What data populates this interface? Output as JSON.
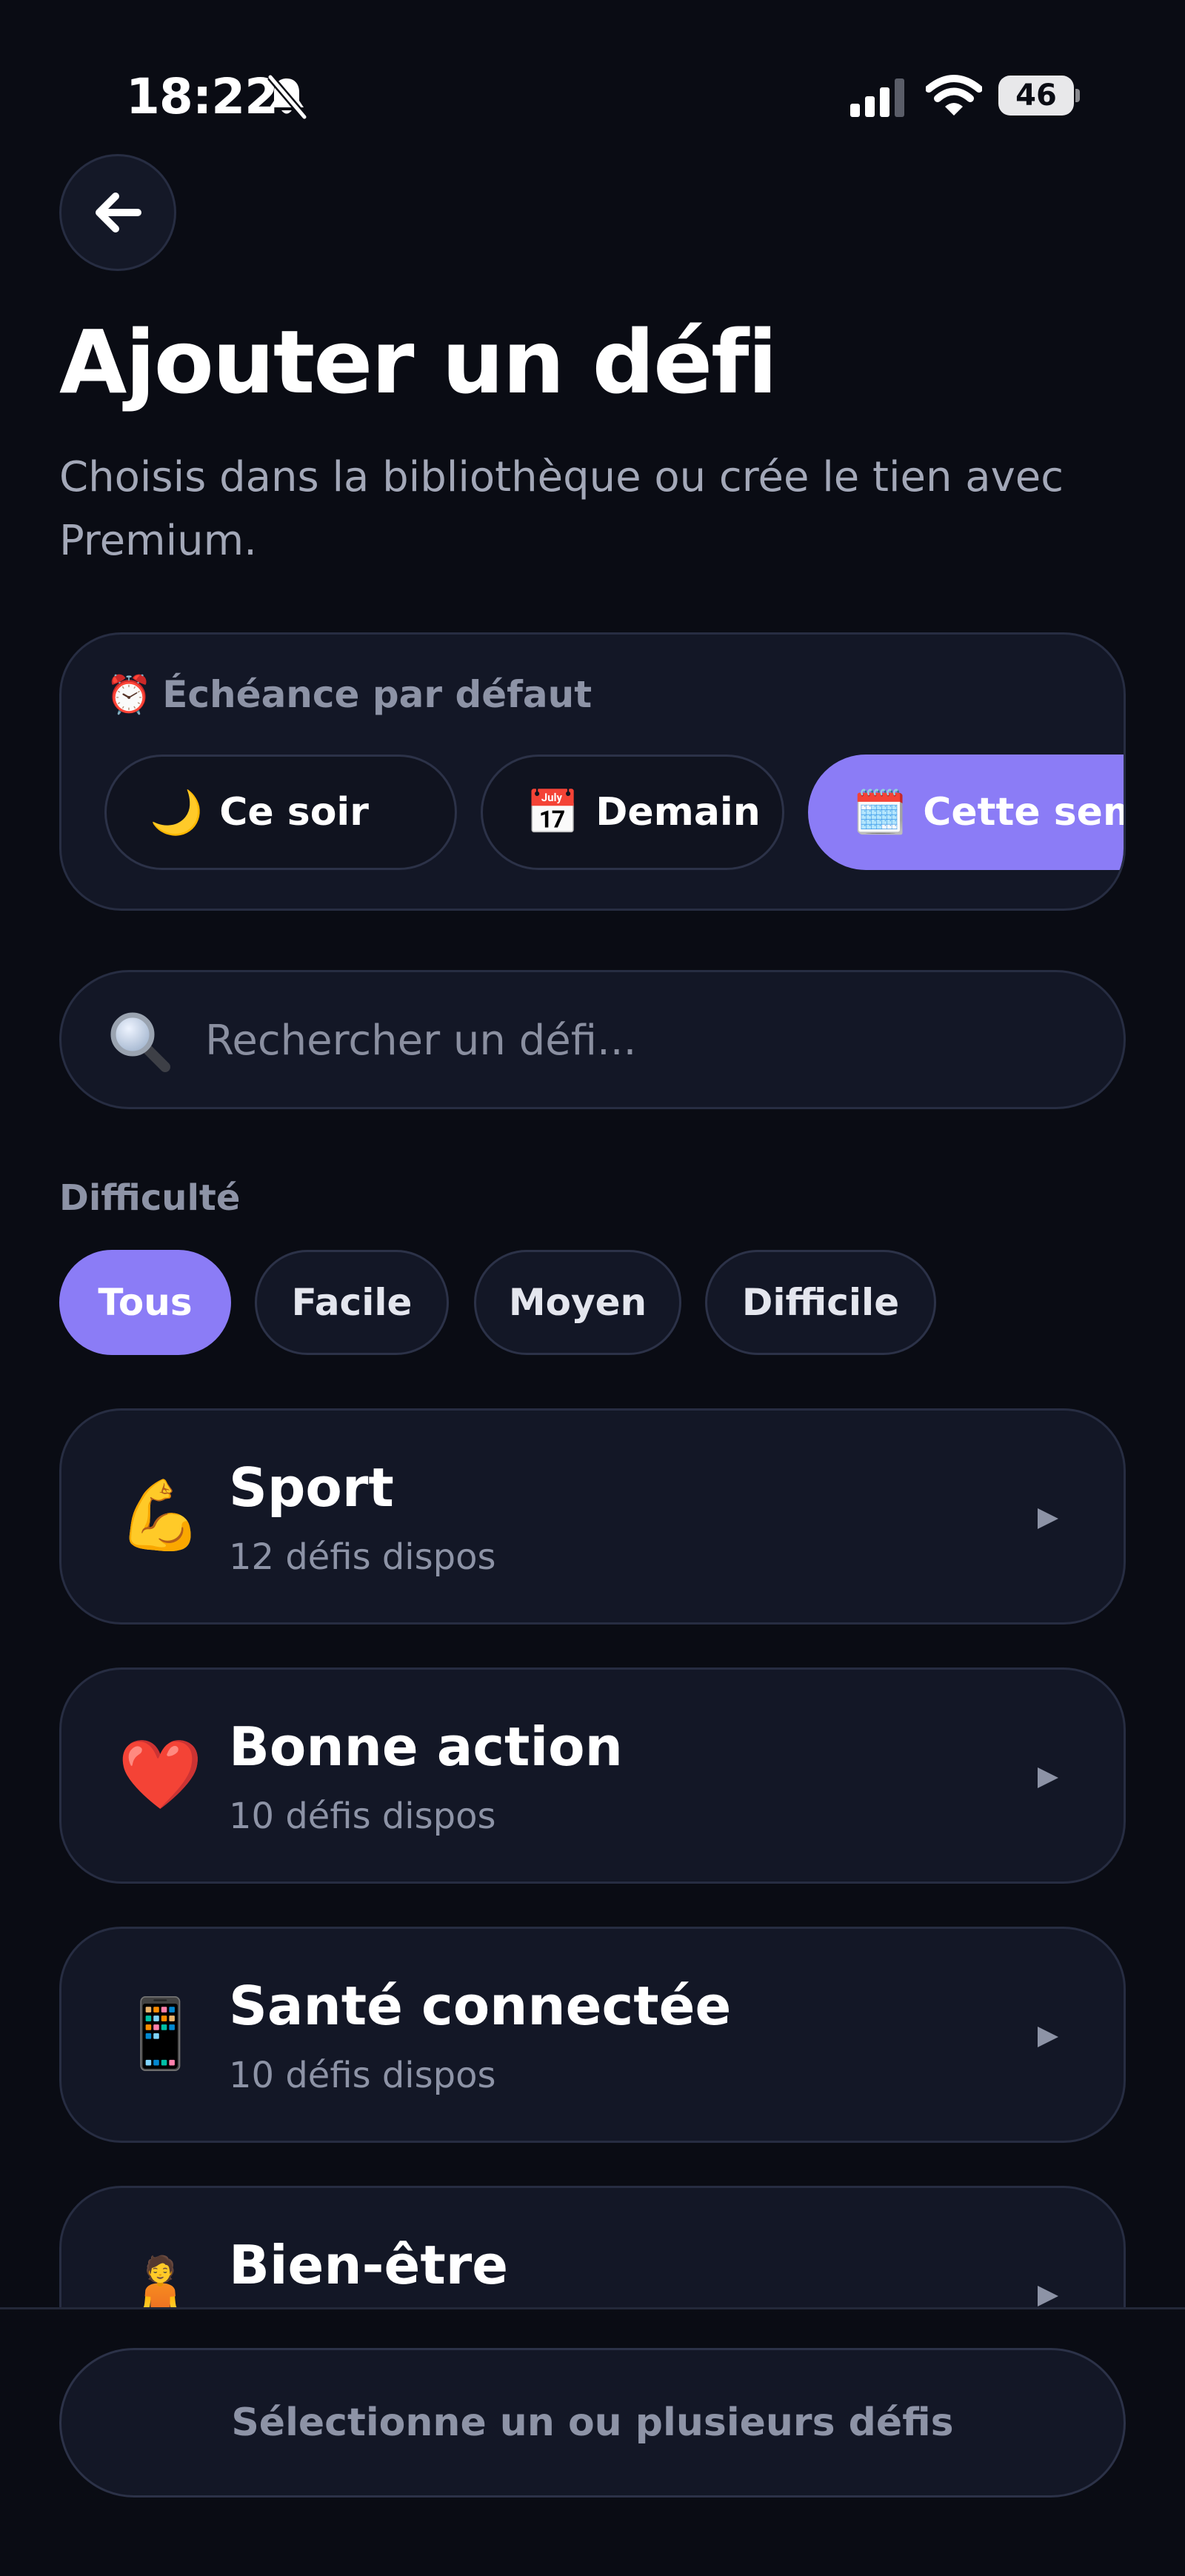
{
  "status_bar": {
    "time": "18:22",
    "battery": "46",
    "icons": [
      "bell-slash-icon",
      "signal-icon",
      "wifi-icon",
      "battery-icon"
    ]
  },
  "header": {
    "back_icon": "arrow-left-icon",
    "title": "Ajouter un défi",
    "subtitle": "Choisis dans la bibliothèque ou crée le tien avec Premium."
  },
  "deadline": {
    "emoji": "⏰",
    "label": "Échéance par défaut",
    "options": [
      {
        "emoji": "🌙",
        "label": "Ce soir",
        "selected": false
      },
      {
        "emoji": "📅",
        "label": "Demain",
        "selected": false
      },
      {
        "emoji": "🗓️",
        "label": "Cette semaine",
        "selected": true
      }
    ]
  },
  "search": {
    "placeholder": "Rechercher un défi...",
    "value": ""
  },
  "difficulty": {
    "label": "Difficulté",
    "options": [
      {
        "label": "Tous",
        "selected": true
      },
      {
        "label": "Facile",
        "selected": false
      },
      {
        "label": "Moyen",
        "selected": false
      },
      {
        "label": "Difficile",
        "selected": false
      }
    ]
  },
  "categories": [
    {
      "emoji": "💪",
      "title": "Sport",
      "count": "12 défis dispos"
    },
    {
      "emoji": "❤️",
      "title": "Bonne action",
      "count": "10 défis dispos"
    },
    {
      "emoji": "📱",
      "title": "Santé connectée",
      "count": "10 défis dispos"
    },
    {
      "emoji": "🧘",
      "title": "Bien-être",
      "count": ""
    }
  ],
  "footer": {
    "select_label": "Sélectionne un ou plusieurs défis"
  },
  "colors": {
    "background": "#0a0c14",
    "card": "#131726",
    "accent": "#8b7cf6",
    "muted_text": "#8d93a6"
  }
}
